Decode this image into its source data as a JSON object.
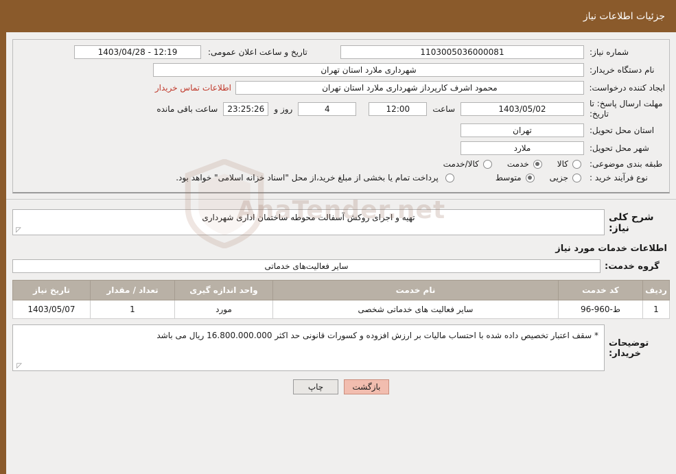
{
  "header": {
    "title": "جزئیات اطلاعات نیاز"
  },
  "watermark": {
    "text": "AnaTender.net"
  },
  "form": {
    "need_number_label": "شماره نیاز:",
    "need_number_value": "1103005036000081",
    "public_announce_label": "تاریخ و ساعت اعلان عمومی:",
    "public_announce_value": "12:19 - 1403/04/28",
    "buyer_org_label": "نام دستگاه خریدار:",
    "buyer_org_value": "شهرداری ملارد استان تهران",
    "creator_label": "ایجاد کننده درخواست:",
    "creator_value": "محمود اشرف کارپرداز  شهرداری ملارد استان تهران",
    "contact_link": "اطلاعات تماس خریدار",
    "deadline_label": "مهلت ارسال پاسخ: تا تاریخ:",
    "deadline_date": "1403/05/02",
    "hour_label": "ساعت",
    "deadline_time": "12:00",
    "days_value": "4",
    "days_label": "روز و",
    "remaining_time": "23:25:26",
    "remaining_label": "ساعت باقی مانده",
    "province_label": "استان محل تحویل:",
    "province_value": "تهران",
    "city_label": "شهر محل تحویل:",
    "city_value": "ملارد",
    "category_label": "طبقه بندی موضوعی:",
    "category_options": [
      {
        "label": "کالا",
        "selected": false
      },
      {
        "label": "خدمت",
        "selected": true
      },
      {
        "label": "کالا/خدمت",
        "selected": false
      }
    ],
    "process_label": "نوع فرآیند خرید :",
    "process_options": [
      {
        "label": "جزیی",
        "selected": false
      },
      {
        "label": "متوسط",
        "selected": true
      }
    ],
    "process_note": "پرداخت تمام یا بخشی از مبلغ خرید،از محل \"اسناد خزانه اسلامی\" خواهد بود."
  },
  "description": {
    "label": "شرح کلی نیاز:",
    "value": "تهیه و اجرای روکش آسفالت محوطه ساختمان اداری شهرداری"
  },
  "services": {
    "section_title": "اطلاعات خدمات مورد نیاز",
    "group_label": "گروه خدمت:",
    "group_value": "سایر فعالیت‌های خدماتی",
    "table": {
      "headers": [
        "ردیف",
        "کد خدمت",
        "نام خدمت",
        "واحد اندازه گیری",
        "تعداد / مقدار",
        "تاریخ نیاز"
      ],
      "rows": [
        [
          "1",
          "ط-960-96",
          "سایر فعالیت های خدماتی شخصی",
          "مورد",
          "1",
          "1403/05/07"
        ]
      ]
    }
  },
  "buyer_notes": {
    "label": "توضیحات خریدار:",
    "value": "* سقف اعتبار تخصیص داده شده با احتساب مالیات بر ارزش افزوده و کسورات قانونی حد اکثر 16.800.000.000 ریال می باشد"
  },
  "buttons": {
    "print": "چاپ",
    "back": "بازگشت"
  }
}
